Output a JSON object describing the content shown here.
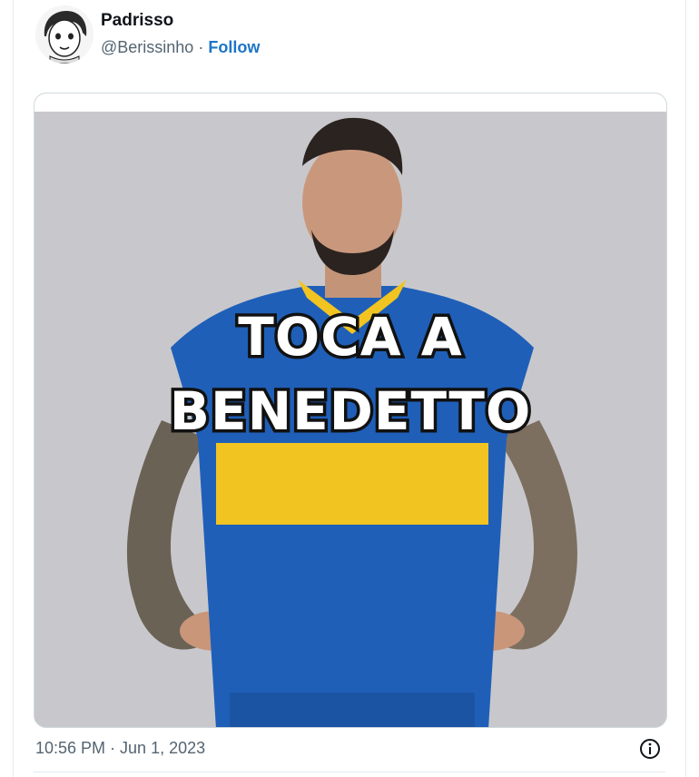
{
  "tweet": {
    "author": {
      "display_name": "Padrisso",
      "handle": "@Berissinho",
      "separator": "·",
      "follow_label": "Follow"
    },
    "media": {
      "caption_line_1": "TOCA A",
      "caption_line_2": "BENEDETTO"
    },
    "timestamp": "10:56 PM · Jun 1, 2023"
  },
  "colors": {
    "accent": "#1d74c8",
    "jersey_blue": "#1f5fb8",
    "jersey_yellow": "#f2c421",
    "background_gray": "#cbcbcf"
  },
  "icons": [
    "avatar",
    "info-icon"
  ]
}
